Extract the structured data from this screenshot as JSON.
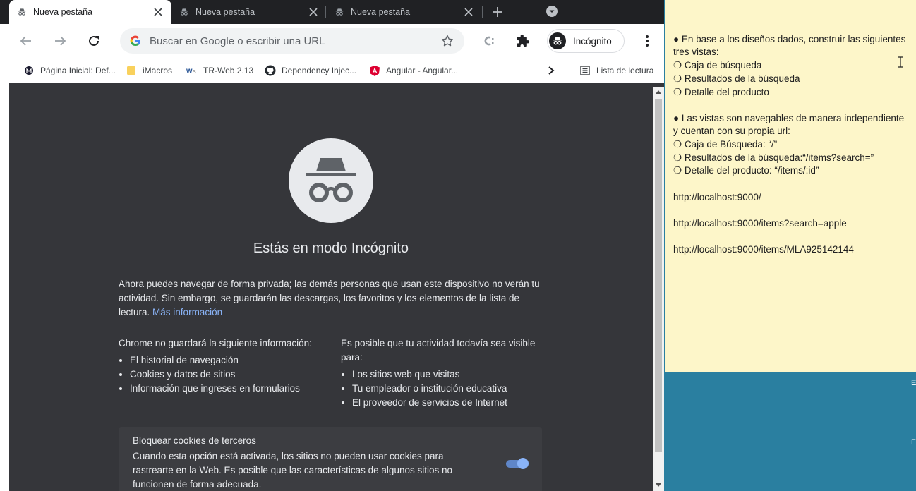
{
  "tabs": [
    {
      "title": "Nueva pestaña",
      "active": true
    },
    {
      "title": "Nueva pestaña",
      "active": false
    },
    {
      "title": "Nueva pestaña",
      "active": false
    }
  ],
  "omnibox": {
    "placeholder": "Buscar en Google o escribir una URL"
  },
  "profile": {
    "label": "Incógnito"
  },
  "bookmarks": [
    {
      "label": "Página Inicial: Def...",
      "icon": "site-icon"
    },
    {
      "label": "iMacros",
      "icon": "folder-icon"
    },
    {
      "label": "TR-Web 2.13",
      "icon": "site-icon"
    },
    {
      "label": "Dependency Injec...",
      "icon": "github-icon"
    },
    {
      "label": "Angular - Angular...",
      "icon": "angular-icon"
    }
  ],
  "reading_list": {
    "label": "Lista de lectura"
  },
  "incognito_page": {
    "headline": "Estás en modo Incógnito",
    "intro": "Ahora puedes navegar de forma privada; las demás personas que usan este dispositivo no verán tu actividad. Sin embargo, se guardarán las descargas, los favoritos y los elementos de la lista de lectura.",
    "learn_more": "Más información",
    "not_saved_title_a": "Chrome ",
    "not_saved_title_b": "no guardará",
    "not_saved_title_c": " la siguiente información:",
    "not_saved_items": [
      "El historial de navegación",
      "Cookies y datos de sitios",
      "Información que ingreses en formularios"
    ],
    "visible_title_a": "Es posible que tu actividad ",
    "visible_title_b": "todavía sea visible",
    "visible_title_c": " para:",
    "visible_items": [
      "Los sitios web que visitas",
      "Tu empleador o institución educativa",
      "El proveedor de servicios de Internet"
    ],
    "cookies_title": "Bloquear cookies de terceros",
    "cookies_desc": "Cuando esta opción está activada, los sitios no pueden usar cookies para rastrearte en la Web. Es posible que las características de algunos sitios no funcionen de forma adecuada.",
    "cookies_toggle_on": true
  },
  "note": {
    "lines": [
      "● En base a los diseños dados, construir las siguientes",
      "tres vistas:",
      " ❍ Caja de búsqueda",
      " ❍ Resultados de la búsqueda",
      " ❍ Detalle del producto",
      "",
      "● Las vistas son navegables de manera independiente",
      "y cuentan con su propia url:",
      " ❍ Caja de Búsqueda: “/”",
      " ❍ Resultados de la búsqueda:“/items?search=”",
      " ❍ Detalle del producto: “/items/:id”",
      "",
      "http://localhost:9000/",
      "",
      "http://localhost:9000/items?search=apple",
      "",
      "http://localhost:9000/items/MLA925142144"
    ]
  },
  "desktop_fragments": [
    "E",
    "F"
  ],
  "colors": {
    "link": "#8ab4f8",
    "note_bg": "#fdf6c9",
    "desktop": "#2a7fa0",
    "incognito_bg": "#35363a"
  }
}
